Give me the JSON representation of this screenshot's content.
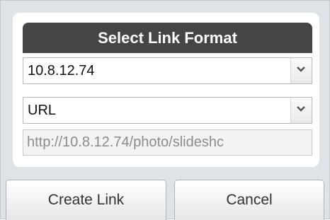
{
  "dialog": {
    "title": "Select Link Format",
    "host_select": {
      "value": "10.8.12.74",
      "arrow_icon": "chevron-down-icon"
    },
    "format_select": {
      "value": "URL",
      "arrow_icon": "chevron-down-icon"
    },
    "link_field": {
      "value": "http://10.8.12.74/photo/slideshc"
    },
    "buttons": {
      "create": "Create Link",
      "cancel": "Cancel"
    }
  },
  "colors": {
    "header_bg": "#454545",
    "dialog_bg": "#dfe3e8",
    "field_text": "#8c8c8c"
  }
}
